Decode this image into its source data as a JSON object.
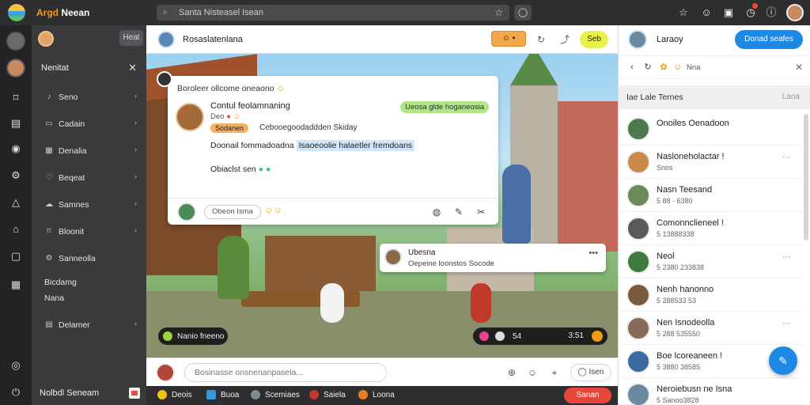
{
  "app": {
    "brand_a": "Argd",
    "brand_b": "Neean"
  },
  "topbar": {
    "search_placeholder": "Santa Nisteasel Isean"
  },
  "sidebar": {
    "header_btn": "Heat",
    "title": "Nenitat",
    "items": [
      {
        "label": "Seno",
        "icon": "sound-icon"
      },
      {
        "label": "Cadain",
        "icon": "document-icon"
      },
      {
        "label": "Denalia",
        "icon": "grid-icon"
      },
      {
        "label": "Beqeat",
        "icon": "heart-icon"
      },
      {
        "label": "Samnes",
        "icon": "cloud-icon"
      },
      {
        "label": "Bloonit",
        "icon": "bookmark-icon"
      },
      {
        "label": "Sanneolla",
        "icon": "settings-icon"
      },
      {
        "label": "Bicdamg",
        "icon": ""
      },
      {
        "label": "Nana",
        "icon": ""
      },
      {
        "label": "Delamer",
        "icon": "table-icon"
      }
    ],
    "footer": "Nolbdl Seneam"
  },
  "main": {
    "header_name": "Rosaslatenlana",
    "header_pill2": "Seb",
    "card": {
      "title": "Boroleer ollcome oneaono",
      "name": "Contul feolamnaning",
      "sub": "Deo",
      "tag": "Ueosa glde hoganeosia",
      "chip": "Sodanen",
      "line2": "Cebooegoodaddden Skiday",
      "line3_a": "Doonail fommadoadna",
      "line3_b": "Isaoeoolie halaetler fremdoans",
      "line4": "Obiaclst sen",
      "reply": "Obeon Isma"
    },
    "notif": {
      "title": "Ubesna",
      "body": "Oepeine loonstos Socode"
    },
    "pill_left": "Nanio fneeno",
    "pill_right": {
      "label": "54",
      "time": "3:51"
    },
    "compose": {
      "placeholder": "Bosinasse onsnenanpasela...",
      "pill": "Isen"
    },
    "bottom": [
      {
        "label": "Deois",
        "color": "#f1c40f"
      },
      {
        "label": "Buoa",
        "color": "#3498db"
      },
      {
        "label": "Scemiaes",
        "color": "#7f8c8d"
      },
      {
        "label": "Saiela",
        "color": "#c0392b"
      },
      {
        "label": "Loona",
        "color": "#e67e22"
      }
    ],
    "bottom_cta": "Sanan"
  },
  "right": {
    "name": "Laraoy",
    "cta": "Donad seafes",
    "tools_label": "Nna",
    "section": "Iae Lale Ternes",
    "section_right": "Lana",
    "rows": [
      {
        "title": "Onoiles Oenadoon",
        "meta": "",
        "color": "#4d7a4d"
      },
      {
        "title": "Nasloneholactar !",
        "meta": "Snos",
        "color": "#c98a4a"
      },
      {
        "title": "Nasn Teesand",
        "meta": "5 88 · 6380",
        "color": "#6a8a5a"
      },
      {
        "title": "Comonnclieneel !",
        "meta": "5 13888338",
        "color": "#5a5a5a"
      },
      {
        "title": "Neol",
        "meta": "5 2380 233838",
        "color": "#3f7a3f"
      },
      {
        "title": "Nenh hanonno",
        "meta": "5 288533 53",
        "color": "#7a5a3a"
      },
      {
        "title": "Nen Isnodeolla",
        "meta": "5 288 535550",
        "color": "#8a6a5a"
      },
      {
        "title": "Boe lcoreaneen !",
        "meta": "5 3880 38585",
        "color": "#3a6aa0"
      },
      {
        "title": "Neroiebusn ne Isna",
        "meta": "5 Sanoo3828",
        "color": "#6a8aa0"
      }
    ]
  }
}
